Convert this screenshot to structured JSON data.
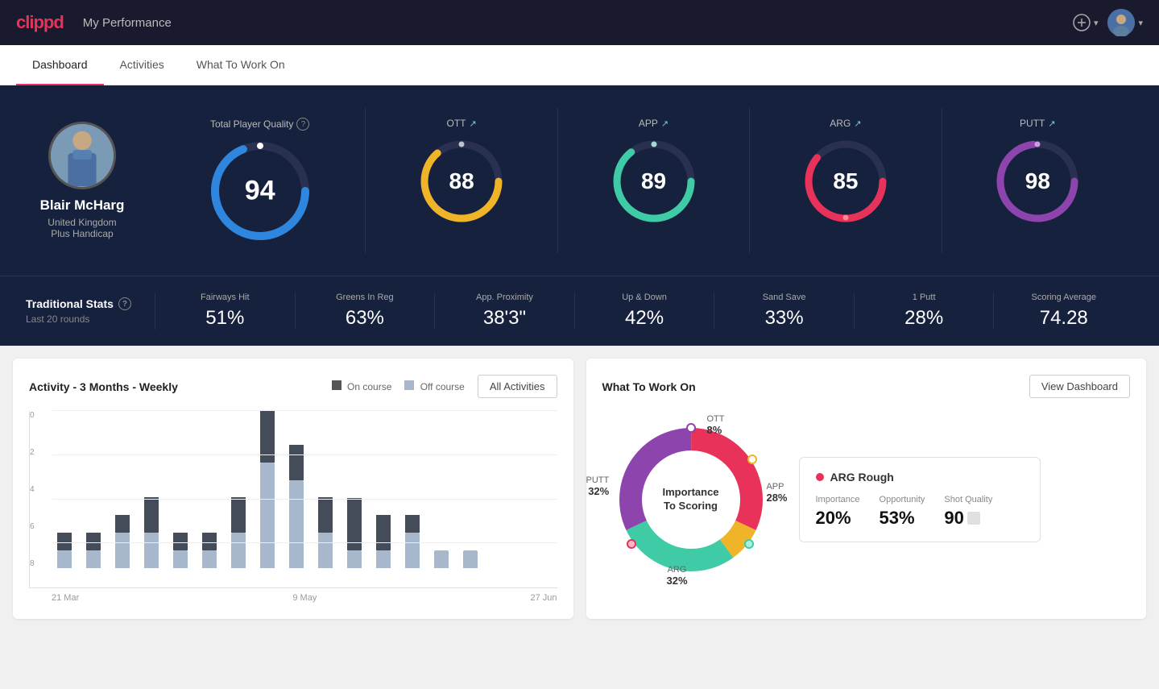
{
  "app": {
    "logo": "clippd",
    "logo_clip": "clip",
    "logo_pd": "pd"
  },
  "header": {
    "title": "My Performance",
    "add_label": "+",
    "avatar_chevron": "▾"
  },
  "tabs": [
    {
      "id": "dashboard",
      "label": "Dashboard",
      "active": true
    },
    {
      "id": "activities",
      "label": "Activities",
      "active": false
    },
    {
      "id": "what-to-work-on",
      "label": "What To Work On",
      "active": false
    }
  ],
  "player": {
    "name": "Blair McHarg",
    "country": "United Kingdom",
    "handicap": "Plus Handicap"
  },
  "total_quality": {
    "label": "Total Player Quality",
    "value": 94,
    "color": "#2e86de"
  },
  "metrics": [
    {
      "id": "ott",
      "label": "OTT",
      "value": 88,
      "color": "#f0b429",
      "trend": "↗"
    },
    {
      "id": "app",
      "label": "APP",
      "value": 89,
      "color": "#3ecba5",
      "trend": "↗"
    },
    {
      "id": "arg",
      "label": "ARG",
      "value": 85,
      "color": "#e8325a",
      "trend": "↗"
    },
    {
      "id": "putt",
      "label": "PUTT",
      "value": 98,
      "color": "#8e44ad",
      "trend": "↗"
    }
  ],
  "traditional_stats": {
    "title": "Traditional Stats",
    "subtitle": "Last 20 rounds",
    "items": [
      {
        "label": "Fairways Hit",
        "value": "51%"
      },
      {
        "label": "Greens In Reg",
        "value": "63%"
      },
      {
        "label": "App. Proximity",
        "value": "38'3\""
      },
      {
        "label": "Up & Down",
        "value": "42%"
      },
      {
        "label": "Sand Save",
        "value": "33%"
      },
      {
        "label": "1 Putt",
        "value": "28%"
      },
      {
        "label": "Scoring Average",
        "value": "74.28"
      }
    ]
  },
  "activity_chart": {
    "title": "Activity - 3 Months - Weekly",
    "legend": {
      "on_course": "On course",
      "off_course": "Off course"
    },
    "all_activities_btn": "All Activities",
    "x_labels": [
      "21 Mar",
      "9 May",
      "27 Jun"
    ],
    "y_labels": [
      "0",
      "2",
      "4",
      "6",
      "8"
    ],
    "bars": [
      {
        "on": 1,
        "off": 1
      },
      {
        "on": 1,
        "off": 1
      },
      {
        "on": 1,
        "off": 2
      },
      {
        "on": 2,
        "off": 2
      },
      {
        "on": 1,
        "off": 1
      },
      {
        "on": 1,
        "off": 1
      },
      {
        "on": 2,
        "off": 2
      },
      {
        "on": 3,
        "off": 6
      },
      {
        "on": 2,
        "off": 5
      },
      {
        "on": 2,
        "off": 2
      },
      {
        "on": 3,
        "off": 1
      },
      {
        "on": 2,
        "off": 1
      },
      {
        "on": 1,
        "off": 2
      },
      {
        "on": 0,
        "off": 1
      },
      {
        "on": 0,
        "off": 1
      }
    ]
  },
  "what_to_work_on": {
    "title": "What To Work On",
    "view_dashboard_btn": "View Dashboard",
    "donut_center": "Importance\nTo Scoring",
    "segments": [
      {
        "id": "ott",
        "label": "OTT",
        "value": "8%",
        "color": "#f0b429",
        "pct": 8
      },
      {
        "id": "app",
        "label": "APP",
        "value": "28%",
        "color": "#3ecba5",
        "pct": 28
      },
      {
        "id": "arg",
        "label": "ARG",
        "value": "32%",
        "color": "#e8325a",
        "pct": 32
      },
      {
        "id": "putt",
        "label": "PUTT",
        "value": "32%",
        "color": "#8e44ad",
        "pct": 32
      }
    ],
    "arg_card": {
      "title": "ARG Rough",
      "dot_color": "#e8325a",
      "importance_label": "Importance",
      "importance_value": "20%",
      "opportunity_label": "Opportunity",
      "opportunity_value": "53%",
      "shot_quality_label": "Shot Quality",
      "shot_quality_value": "90"
    }
  }
}
